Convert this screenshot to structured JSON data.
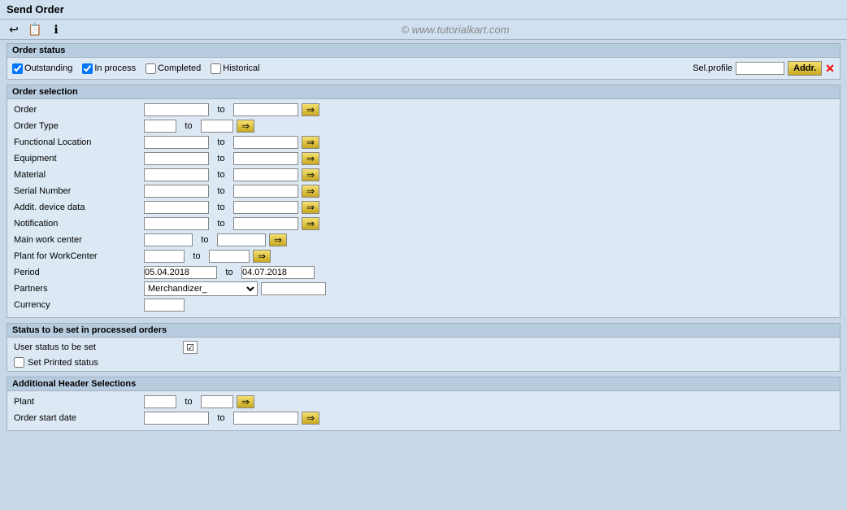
{
  "title": "Send Order",
  "toolbar": {
    "icons": [
      "↩",
      "📋",
      "ℹ"
    ]
  },
  "watermark": "© www.tutorialkart.com",
  "order_status": {
    "label": "Order status",
    "outstanding": {
      "label": "Outstanding",
      "checked": true
    },
    "in_process": {
      "label": "In process",
      "checked": true
    },
    "completed": {
      "label": "Completed",
      "checked": false
    },
    "historical": {
      "label": "Historical",
      "checked": false
    },
    "sel_profile_label": "Sel.profile",
    "sel_profile_value": "",
    "addr_btn": "Addr."
  },
  "order_selection": {
    "label": "Order selection",
    "fields": [
      {
        "label": "Order",
        "input1_width": 80,
        "input2_width": 80,
        "has_arrow": true
      },
      {
        "label": "Order Type",
        "input1_width": 40,
        "input2_width": 40,
        "has_arrow": true
      },
      {
        "label": "Functional Location",
        "input1_width": 80,
        "input2_width": 80,
        "has_arrow": true
      },
      {
        "label": "Equipment",
        "input1_width": 80,
        "input2_width": 80,
        "has_arrow": true
      },
      {
        "label": "Material",
        "input1_width": 80,
        "input2_width": 80,
        "has_arrow": true
      },
      {
        "label": "Serial Number",
        "input1_width": 80,
        "input2_width": 80,
        "has_arrow": true
      },
      {
        "label": "Addit. device data",
        "input1_width": 80,
        "input2_width": 80,
        "has_arrow": true
      },
      {
        "label": "Notification",
        "input1_width": 80,
        "input2_width": 80,
        "has_arrow": true
      },
      {
        "label": "Main work center",
        "input1_width": 60,
        "input2_width": 60,
        "has_arrow": true
      },
      {
        "label": "Plant for WorkCenter",
        "input1_width": 50,
        "input2_width": 50,
        "has_arrow": true
      }
    ],
    "period": {
      "label": "Period",
      "from": "05.04.2018",
      "to": "04.07.2018"
    },
    "partners": {
      "label": "Partners",
      "value": "Merchandizer_"
    },
    "currency": {
      "label": "Currency",
      "value": ""
    }
  },
  "status_section": {
    "label": "Status to be set in processed orders",
    "user_status_label": "User status to be set",
    "user_status_checked": true,
    "set_printed_label": "Set Printed status",
    "set_printed_checked": false
  },
  "additional_header": {
    "label": "Additional Header Selections",
    "fields": [
      {
        "label": "Plant",
        "input1_width": 40,
        "input2_width": 40,
        "has_arrow": true
      },
      {
        "label": "Order start date",
        "input1_width": 80,
        "input2_width": 80,
        "has_arrow": true
      }
    ]
  }
}
